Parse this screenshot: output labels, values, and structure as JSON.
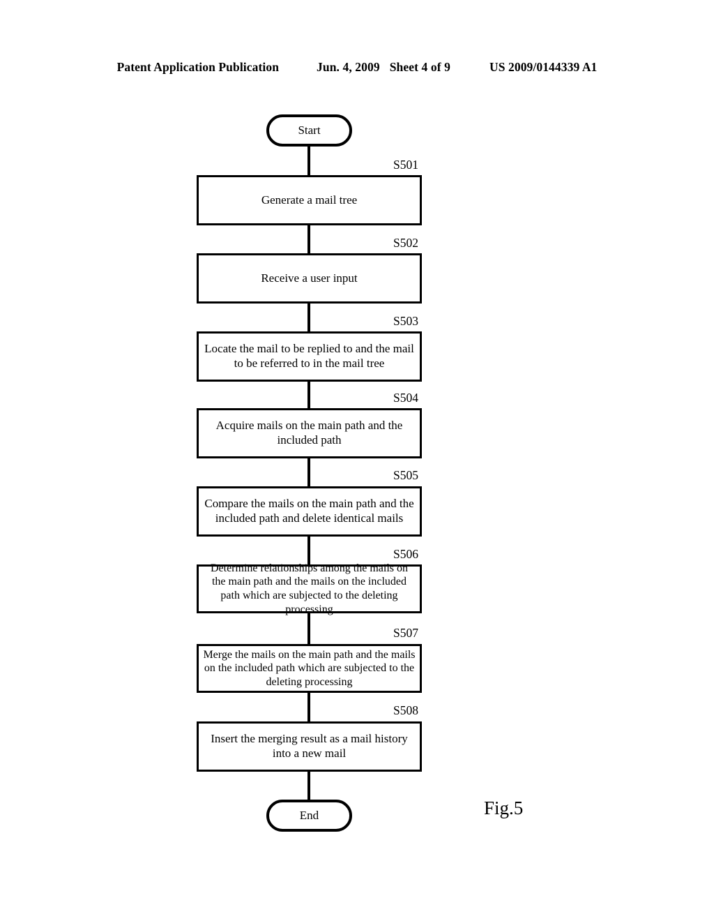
{
  "header": {
    "publication": "Patent Application Publication",
    "date": "Jun. 4, 2009",
    "sheet": "Sheet 4 of 9",
    "number": "US 2009/0144339 A1"
  },
  "figure": {
    "caption": "Fig.5"
  },
  "flowchart": {
    "start_label": "Start",
    "end_label": "End",
    "steps": [
      {
        "id": "S501",
        "text": "Generate a mail tree"
      },
      {
        "id": "S502",
        "text": "Receive a user input"
      },
      {
        "id": "S503",
        "text": "Locate the mail to be replied to and the mail to be referred to in the mail tree"
      },
      {
        "id": "S504",
        "text": "Acquire mails on the main path and the included path"
      },
      {
        "id": "S505",
        "text": "Compare the mails on the main path and the included path and delete identical mails"
      },
      {
        "id": "S506",
        "text": "Determine relationships among the mails on the main path and the mails on the included path which are subjected to the deleting processing"
      },
      {
        "id": "S507",
        "text": "Merge the mails on the main path and the mails on the included path which are subjected to the deleting processing"
      },
      {
        "id": "S508",
        "text": "Insert the merging result as a mail history into a new mail"
      }
    ]
  }
}
